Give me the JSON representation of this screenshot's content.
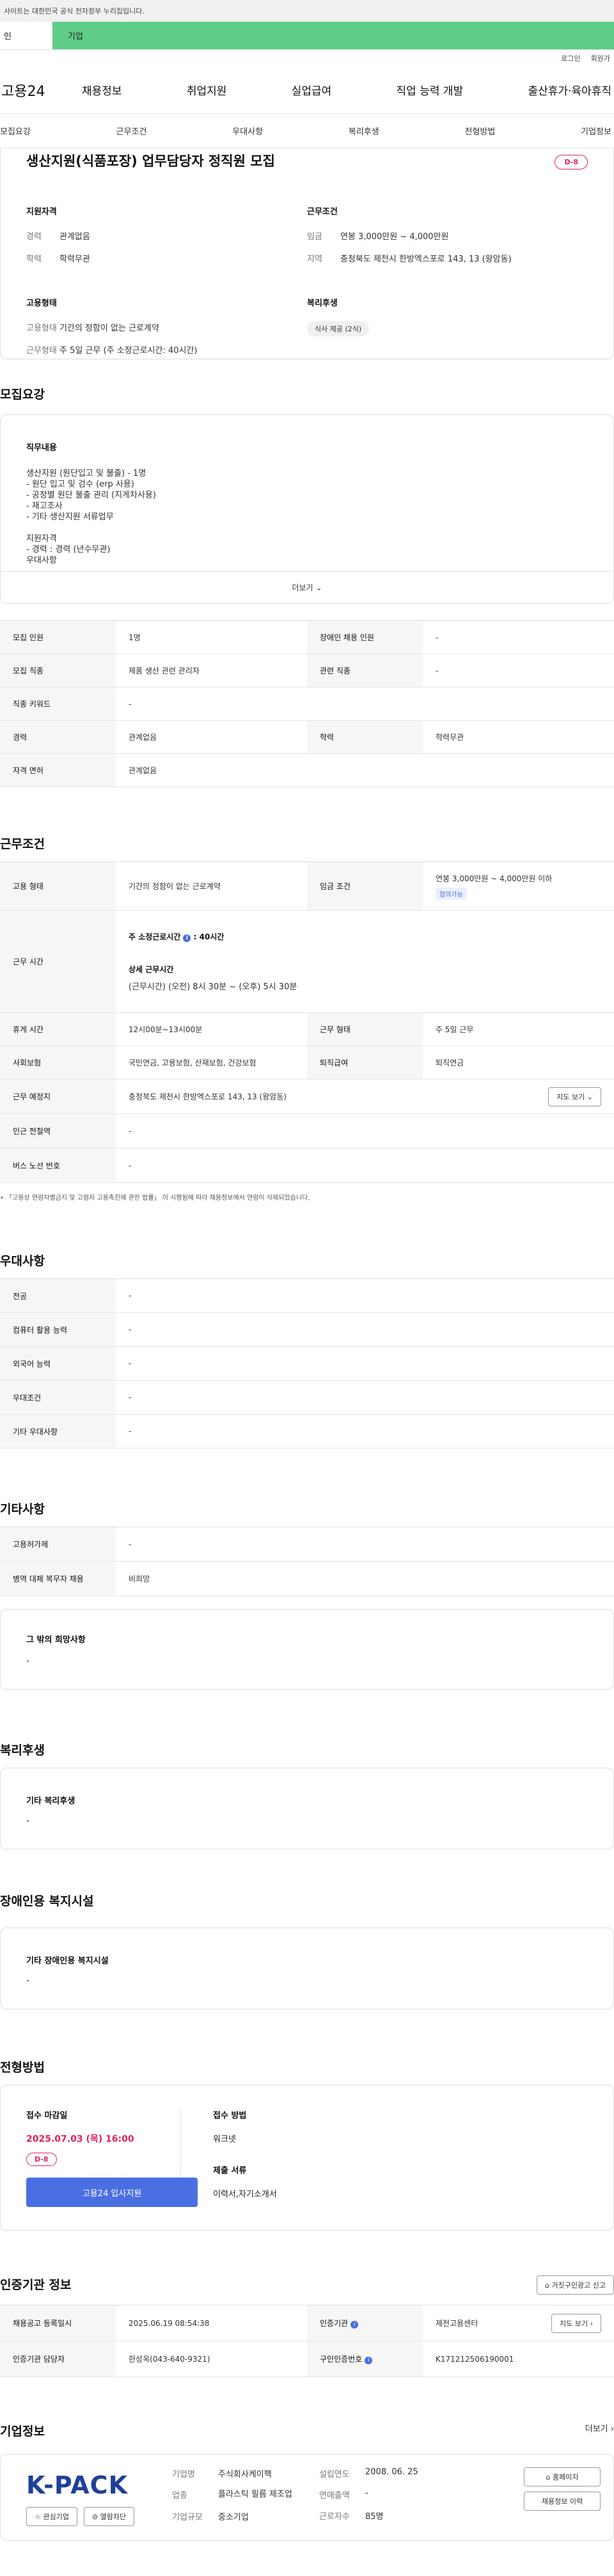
{
  "gov_bar": "사이트는 대한민국 공식 전자정부 누리집입니다.",
  "tabs": [
    "인",
    "기업"
  ],
  "util": [
    "로그인",
    "회원가"
  ],
  "logo": "고용24",
  "gnb": [
    "채용정보",
    "취업지원",
    "실업급여",
    "직업 능력 개발",
    "출산휴가·육아휴직"
  ],
  "anchor_nav": [
    "모집요강",
    "근무조건",
    "우대사항",
    "복리후생",
    "전형방법",
    "기업정보"
  ],
  "job": {
    "title": "생산지원(식품포장) 업무담당자 정직원 모집",
    "dday": "D-8"
  },
  "summary": {
    "qual_h": "지원자격",
    "exp_k": "경력",
    "exp_v": "관계없음",
    "edu_k": "학력",
    "edu_v": "학력무관",
    "cond_h": "근무조건",
    "pay_k": "임금",
    "pay_v": "연봉 3,000만원 ~ 4,000만원",
    "loc_k": "지역",
    "loc_v": "충청북도 제천시 한방엑스포로 143, 13 (왕암동)",
    "emp_h": "고용형태",
    "type_k": "고용형태",
    "type_v": "기간의 정함이 없는 근로계약",
    "wk_k": "근무형태",
    "wk_v": "주 5일 근무 (주 소정근로시간: 40시간)",
    "ben_h": "복리후생",
    "ben_tag": "식사 제공 (2식)"
  },
  "recruit": {
    "title": "모집요강",
    "duty_h": "직무내용",
    "duty_lines": [
      "생산지원 (원단입고 및 불출) - 1명",
      "- 원단 입고 및 검수 (erp 사용)",
      "- 공정별 원단 불출 관리 (지게차사용)",
      "- 재고조사",
      "- 기타 생산지원 서류업무",
      "",
      "지원자격",
      "- 경력 : 경력 (년수무관)",
      "우대사항"
    ],
    "more": "더보기",
    "rows": [
      {
        "k1": "모집 인원",
        "v1": "1명",
        "k2": "장애인 채용 인원",
        "v2": "-"
      },
      {
        "k1": "모집 직종",
        "v1": "제품 생산 관련 관리자",
        "k2": "관련 직종",
        "v2": "-"
      },
      {
        "k1": "직종 키워드",
        "v1": "-"
      },
      {
        "k1": "경력",
        "v1": "관계없음",
        "k2": "학력",
        "v2": "학력무관"
      },
      {
        "k1": "자격 면허",
        "v1": "관계없음"
      }
    ]
  },
  "work": {
    "title": "근무조건",
    "emp_k": "고용 형태",
    "emp_v": "기간의 정함이 없는 근로계약",
    "pay_k": "임금 조건",
    "pay_v": "연봉 3,000만원 ~ 4,000만원 이하",
    "pay_tag": "협의가능",
    "time_k": "근무 시간",
    "time_weekly": "주 소정근로시간",
    "time_weekly_v": ": 40시간",
    "time_detail_h": "상세 근무시간",
    "time_detail_v": "(근무시간) (오전) 8시 30분 ~ (오후) 5시 30분",
    "rest_k": "휴게 시간",
    "rest_v": "12시00분~13시00분",
    "form_k": "근무 형태",
    "form_v": "주 5일 근무",
    "ins_k": "사회보험",
    "ins_v": "국민연금, 고용보험, 산재보험, 건강보험",
    "sev_k": "퇴직급여",
    "sev_v": "퇴직연금",
    "place_k": "근무 예정지",
    "place_v": "충청북도 제천시 한방엑스포로 143, 13 (왕암동)",
    "map_btn": "지도 보기",
    "sub_k": "인근 전철역",
    "sub_v": "-",
    "bus_k": "버스 노선 번호",
    "bus_v": "-",
    "note": "「고용상 연령차별금지 및 고령자 고용촉진에 관한 법률」 이 시행됨에 따라 채용정보에서 연령이 삭제되었습니다."
  },
  "pref": {
    "title": "우대사항",
    "rows": [
      {
        "k": "전공",
        "v": "-"
      },
      {
        "k": "컴퓨터 활용 능력",
        "v": "-"
      },
      {
        "k": "외국어 능력",
        "v": "-"
      },
      {
        "k": "우대조건",
        "v": "-"
      },
      {
        "k": "기타 우대사항",
        "v": "-"
      }
    ]
  },
  "etc": {
    "title": "기타사항",
    "rows": [
      {
        "k": "고용허가제",
        "v": "-"
      },
      {
        "k": "병역 대체 복무자 채용",
        "v": "비희망"
      }
    ],
    "hope_h": "그 밖의 희망사항",
    "hope_v": "-"
  },
  "welfare": {
    "title": "복리후생",
    "h": "기타 복리후생",
    "v": "-"
  },
  "disab": {
    "title": "장애인용 복지시설",
    "h": "기타 장애인용 복지시설",
    "v": "-"
  },
  "process": {
    "title": "전형방법",
    "deadline_h": "접수 마감일",
    "deadline_v": "2025.07.03 (목) 16:00",
    "dday": "D-8",
    "apply_btn": "고용24 입사지원",
    "method_h": "접수 방법",
    "method_v": "워크넷",
    "docs_h": "제출 서류",
    "docs_v": "이력서,자기소개서"
  },
  "agency": {
    "title": "인증기관 정보",
    "report_btn": "거짓구인광고 신고",
    "reg_k": "채용공고 등록일시",
    "reg_v": "2025.06.19 08:54:38",
    "org_k": "인증기관",
    "org_v": "제천고용센터",
    "map_btn": "지도 보기",
    "mgr_k": "인증기관 담당자",
    "mgr_v": "한성옥(043-640-9321)",
    "num_k": "구인인증번호",
    "num_v": "K171212506190001"
  },
  "company": {
    "title": "기업정보",
    "more": "더보기",
    "logo": "K-PACK",
    "fav_btn": "관심기업",
    "block_btn": "열람차단",
    "name_k": "기업명",
    "name_v": "주식회사케이팩",
    "ind_k": "업종",
    "ind_v": "플라스틱 필름 제조업",
    "size_k": "기업규모",
    "size_v": "중소기업",
    "year_k": "설립연도",
    "year_v": "2008. 06. 25",
    "sales_k": "연매출액",
    "sales_v": "-",
    "emp_k": "근로자수",
    "emp_v": "85명",
    "home_btn": "홈페이지",
    "other_btn": "채용정보 이력"
  },
  "colors": {
    "green": "#5fcd88",
    "pink": "#e0245e",
    "blue": "#4a6fe3"
  }
}
